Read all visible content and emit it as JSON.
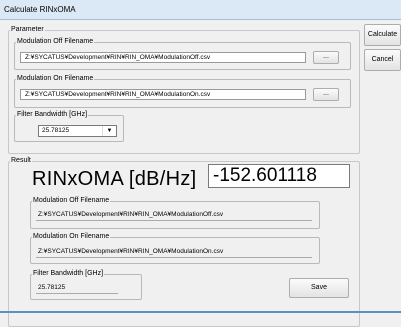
{
  "window": {
    "title": "Calculate RINxOMA"
  },
  "buttons": {
    "calculate": "Calculate",
    "cancel": "Cancel",
    "save": "Save",
    "browse": "..."
  },
  "parameter": {
    "legend": "Parameter",
    "mod_off": {
      "label": "Modulation Off Filename",
      "value": "Z:¥SYCATUS¥Development¥RIN¥RIN_OMA¥ModulationOff.csv"
    },
    "mod_on": {
      "label": "Modulation On Filename",
      "value": "Z:¥SYCATUS¥Development¥RIN¥RIN_OMA¥ModulationOn.csv"
    },
    "filter": {
      "label": "Filter Bandwidth [GHz]",
      "value": "25.78125",
      "arrow": "▼"
    }
  },
  "result": {
    "legend": "Result",
    "title": "RINxOMA [dB/Hz]",
    "value": "-152.601118",
    "mod_off": {
      "label": "Modulation Off Filename",
      "value": "Z:¥SYCATUS¥Development¥RIN¥RIN_OMA¥ModulationOff.csv"
    },
    "mod_on": {
      "label": "Modulation On Filename",
      "value": "Z:¥SYCATUS¥Development¥RIN¥RIN_OMA¥ModulationOn.csv"
    },
    "filter": {
      "label": "Filter Bandwidth [GHz]",
      "value": "25.78125"
    }
  }
}
